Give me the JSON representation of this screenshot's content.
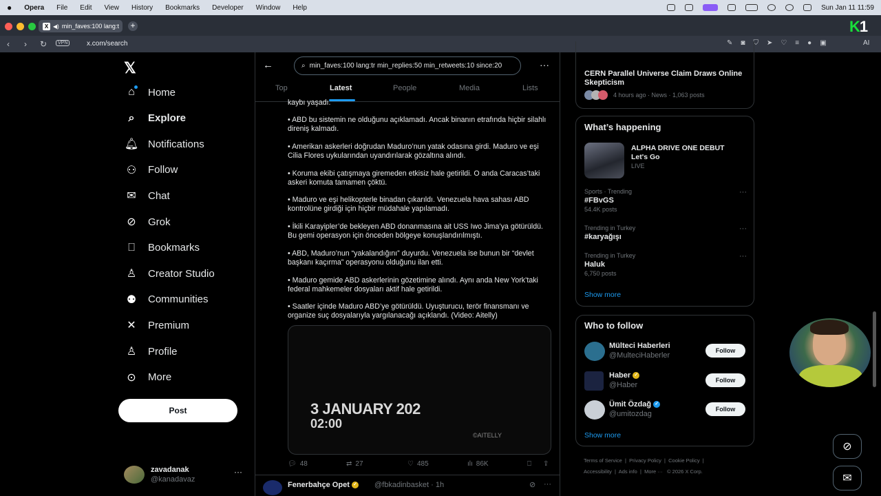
{
  "os_menubar": {
    "apple": "",
    "app_name": "Opera",
    "items": [
      "File",
      "Edit",
      "View",
      "History",
      "Bookmarks",
      "Developer",
      "Window",
      "Help"
    ],
    "clock": "Sun Jan 11  11:59"
  },
  "browser": {
    "tab_title": "min_faves:100 lang:t",
    "vpn_label": "VPN",
    "url": "x.com/search",
    "ai_label": "AI",
    "badge_letter": "K",
    "badge_number": "1"
  },
  "left_nav": {
    "items": [
      {
        "label": "Home",
        "icon": "home-icon"
      },
      {
        "label": "Explore",
        "icon": "search-icon",
        "active": true
      },
      {
        "label": "Notifications",
        "icon": "bell-icon"
      },
      {
        "label": "Follow",
        "icon": "person-plus-icon"
      },
      {
        "label": "Chat",
        "icon": "mail-icon"
      },
      {
        "label": "Grok",
        "icon": "grok-icon"
      },
      {
        "label": "Bookmarks",
        "icon": "bookmark-icon"
      },
      {
        "label": "Creator Studio",
        "icon": "creator-icon"
      },
      {
        "label": "Communities",
        "icon": "communities-icon"
      },
      {
        "label": "Premium",
        "icon": "x-icon"
      },
      {
        "label": "Profile",
        "icon": "person-icon"
      },
      {
        "label": "More",
        "icon": "more-circle-icon"
      }
    ],
    "post_label": "Post",
    "account": {
      "name": "zavadanak",
      "handle": "@kanadavaz"
    }
  },
  "search": {
    "query": "min_faves:100 lang:tr min_replies:50 min_retweets:10 since:20",
    "tabs": [
      "Top",
      "Latest",
      "People",
      "Media",
      "Lists"
    ],
    "active_tab": "Latest"
  },
  "tweet": {
    "bullets": [
      "kaybı yaşadı.",
      "• ABD bu sistemin ne olduğunu açıklamadı. Ancak binanın etrafında hiçbir silahlı direniş kalmadı.",
      "• Amerikan askerleri doğrudan Maduro’nun yatak odasına girdi. Maduro ve eşi Cilia Flores uykularından uyandırılarak gözaltına alındı.",
      "• Koruma ekibi çatışmaya giremeden etkisiz hale getirildi. O anda Caracas’taki askeri komuta tamamen çöktü.",
      "• Maduro ve eşi helikopterle binadan çıkarıldı. Venezuela hava sahası ABD kontrolüne girdiği için hiçbir müdahale yapılamadı.",
      "• İkili Karayipler’de bekleyen ABD donanmasına ait USS Iwo Jima’ya götürüldü. Bu gemi operasyon için önceden bölgeye konuşlandırılmıştı.",
      "• ABD, Maduro’nun “yakalandığını” duyurdu. Venezuela ise bunun bir “devlet başkanı kaçırma” operasyonu olduğunu ilan etti.",
      "• Maduro gemide ABD askerlerinin gözetimine alındı. Aynı anda New York’taki federal mahkemeler dosyaları aktif hale getirildi.",
      "• Saatler içinde Maduro ABD’ye götürüldü. Uyuşturucu, terör finansmanı ve organize suç dosyalarıyla yargılanacağı açıklandı. (Video: Aitelly)"
    ],
    "video": {
      "date": "3 JANUARY 202",
      "time": "02:00",
      "watermark": "©AITELLY"
    },
    "actions": {
      "replies": "48",
      "reposts": "27",
      "likes": "485",
      "views": "86K"
    }
  },
  "next_tweet": {
    "name": "Fenerbahçe Opet",
    "handle": "@fbkadinbasket · 1h"
  },
  "news_card": {
    "headline": "CERN Parallel Universe Claim Draws Online Skepticism",
    "meta": "4 hours ago · News · 1,063 posts"
  },
  "whats_happening": {
    "title": "What’s happening",
    "featured": {
      "title": "ALPHA DRIVE ONE DEBUT Let's Go",
      "status": "LIVE"
    },
    "trends": [
      {
        "context": "Sports · Trending",
        "name": "#FBvGS",
        "posts": "54.4K posts"
      },
      {
        "context": "Trending in Turkey",
        "name": "#karyağışı",
        "posts": ""
      },
      {
        "context": "Trending in Turkey",
        "name": "Haluk",
        "posts": "6,750 posts"
      }
    ],
    "show_more": "Show more"
  },
  "who_to_follow": {
    "title": "Who to follow",
    "accounts": [
      {
        "name": "Mülteci Haberleri",
        "handle": "@MulteciHaberler",
        "badge": ""
      },
      {
        "name": "Haber",
        "handle": "@Haber",
        "badge": "gold"
      },
      {
        "name": "Ümit Özdağ",
        "handle": "@umitozdag",
        "badge": "blue"
      }
    ],
    "follow_label": "Follow",
    "show_more": "Show more"
  },
  "footer": {
    "links": [
      "Terms of Service",
      "Privacy Policy",
      "Cookie Policy",
      "Accessibility",
      "Ads info",
      "More ···",
      "© 2026 X Corp."
    ]
  },
  "colors": {
    "accent": "#1d9bf0",
    "background": "#000000",
    "border": "#2f3336"
  }
}
